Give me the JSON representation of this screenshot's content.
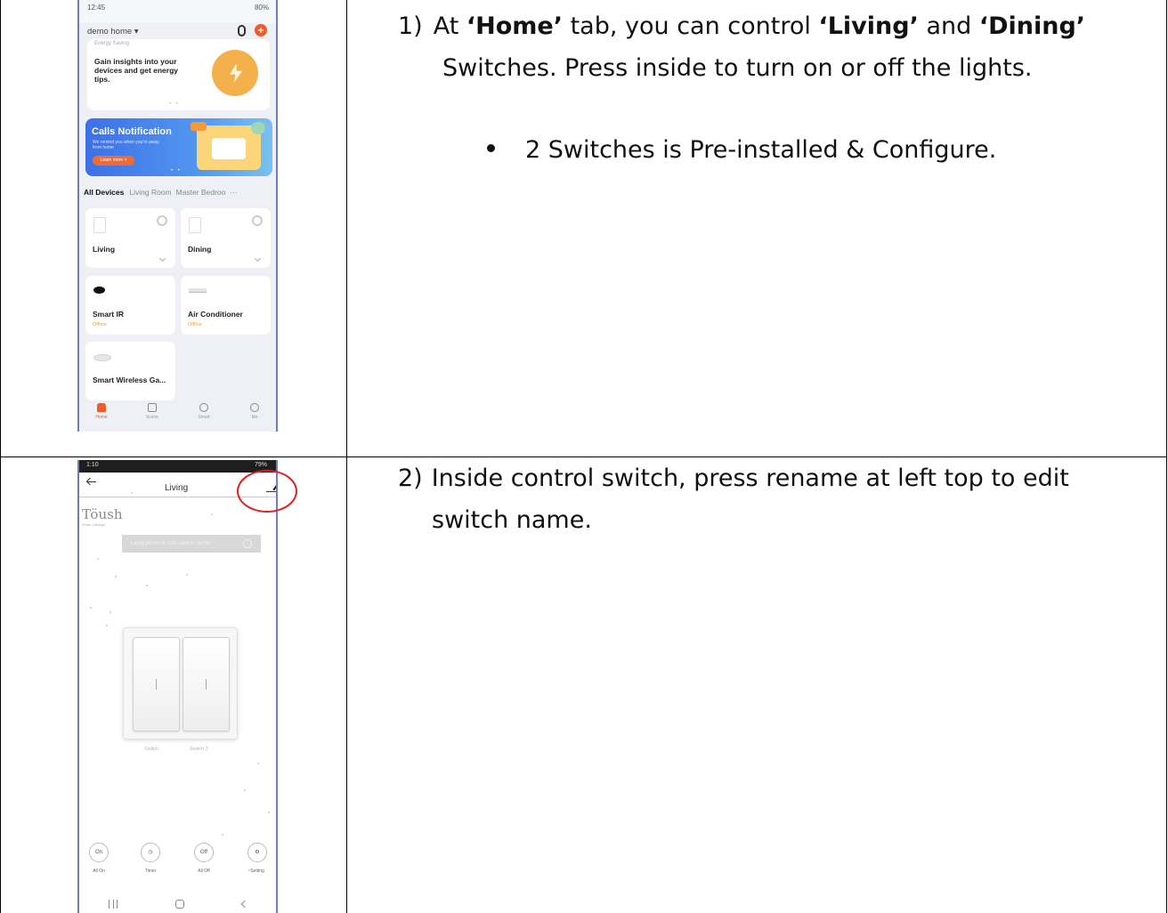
{
  "step1": {
    "number": "1)",
    "part_at": "At ",
    "home": "‘Home’",
    "part_tab": " tab, you can control ",
    "living": "‘Living’",
    "part_and": " and ",
    "dining": "‘Dining’",
    "line2": "Switches. Press inside to turn on or off the lights.",
    "bullet": "2 Switches is Pre-installed & Configure."
  },
  "step2": {
    "number": "2)",
    "line1": "Inside control switch, press rename at left top to edit",
    "line2": "switch name."
  },
  "phone1": {
    "status_time": "12:45",
    "status_right": "80%",
    "home_name": "demo home ▾",
    "energy_caption": "Energy Saving",
    "energy_text": "Gain insights into your devices and get energy tips.",
    "calls_title": "Calls Notification",
    "calls_sub": "We remind you when you're away from home",
    "learn_more": "Learn more >",
    "tabs": {
      "all": "All Devices",
      "living_room": "Living Room",
      "master": "Master Bedroo",
      "more": "···"
    },
    "devices": {
      "living": "Living",
      "dining": "Dining",
      "smart_ir": "Smart IR",
      "smart_ir_status": "Offline",
      "ac": "Air Conditioner",
      "ac_status": "Offline",
      "gateway": "Smart Wireless Ga..."
    },
    "nav": {
      "home": "Home",
      "scene": "Scene",
      "smart": "Smart",
      "me": "Me"
    }
  },
  "phone2": {
    "status_time": "1:10",
    "status_right": "79%",
    "title": "Living",
    "brand": "Töush",
    "brand_sub": "Smart Lifestyle",
    "hint": "Long press to edit switch name",
    "switch1": "Switch",
    "switch2": "Switch 2",
    "controls": {
      "all_on_icon": "On",
      "all_on": "All On",
      "timer": "Timer",
      "all_off_icon": "Off",
      "all_off": "All Off",
      "setting": "Setting"
    }
  },
  "colors": {
    "accent": "#f25a29",
    "banner": "#3c70e8",
    "highlight": "#e02020",
    "offline": "#f5a524"
  }
}
